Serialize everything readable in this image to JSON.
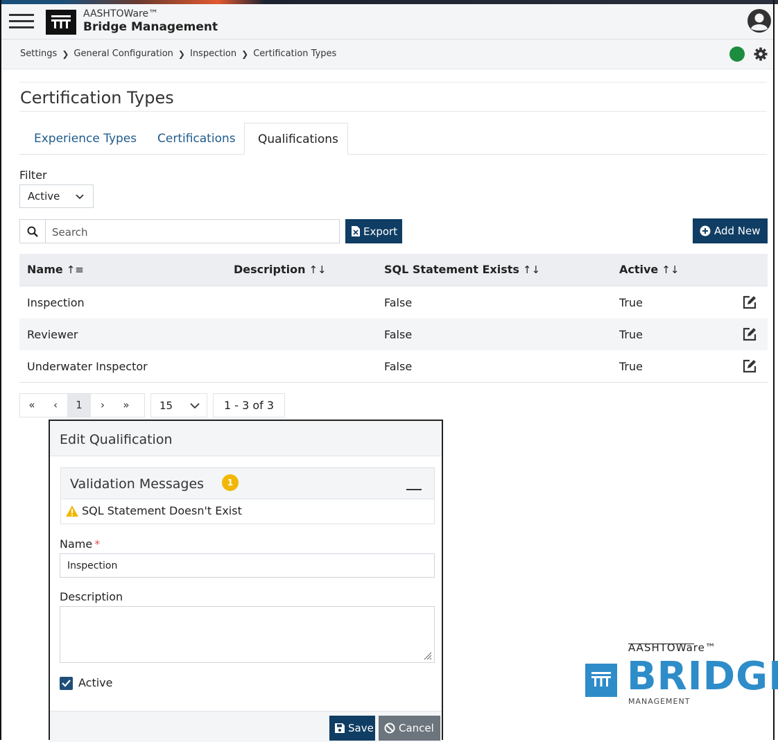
{
  "header": {
    "brand_small": "AASHTOWare™",
    "brand_big": "Bridge Management"
  },
  "breadcrumb": [
    "Settings",
    "General Configuration",
    "Inspection",
    "Certification Types"
  ],
  "status_color": "#1c8c3f",
  "accent_color": "#0f3d63",
  "page_title": "Certification Types",
  "tabs": [
    {
      "label": "Experience Types",
      "active": false
    },
    {
      "label": "Certifications",
      "active": false
    },
    {
      "label": "Qualifications",
      "active": true
    }
  ],
  "filter": {
    "label": "Filter",
    "value": "Active"
  },
  "search": {
    "placeholder": "Search",
    "value": ""
  },
  "buttons": {
    "export": "Export",
    "add_new": "Add New"
  },
  "table": {
    "columns": [
      "Name",
      "Description",
      "SQL Statement Exists",
      "Active"
    ],
    "rows": [
      {
        "name": "Inspection",
        "description": "",
        "sql": "False",
        "active": "True"
      },
      {
        "name": "Reviewer",
        "description": "",
        "sql": "False",
        "active": "True"
      },
      {
        "name": "Underwater Inspector",
        "description": "",
        "sql": "False",
        "active": "True"
      }
    ]
  },
  "pager": {
    "first": "«",
    "prev": "‹",
    "page": "1",
    "next": "›",
    "last": "»",
    "page_size": "15",
    "info": "1 - 3 of 3"
  },
  "dialog": {
    "title": "Edit Qualification",
    "validation_title": "Validation Messages",
    "validation_count": "1",
    "warning": "SQL Statement Doesn't Exist",
    "name_label": "Name",
    "required_mark": "*",
    "name_value": "Inspection",
    "description_label": "Description",
    "description_value": "",
    "active_label": "Active",
    "active_checked": true,
    "save": "Save",
    "cancel": "Cancel"
  },
  "logo": {
    "aashtoware": "AASHTOWare™",
    "bridge": "BRIDGE",
    "management": "MANAGEMENT"
  }
}
